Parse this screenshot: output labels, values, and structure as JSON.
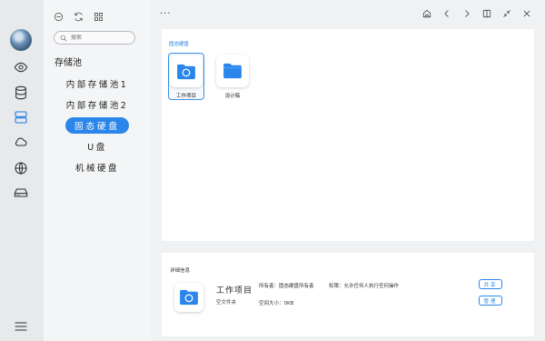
{
  "search": {
    "placeholder": "搜索"
  },
  "nav": {
    "pool_title": "存储池",
    "items": [
      {
        "label": "内部存储池1"
      },
      {
        "label": "内部存储池2"
      },
      {
        "label": "固态硬盘"
      },
      {
        "label": "U盘"
      },
      {
        "label": "机械硬盘"
      }
    ],
    "selected_index": 2
  },
  "main": {
    "more_label": "···",
    "panel_label": "固态硬盘",
    "folders": [
      {
        "label": "工作项目",
        "icon": "folder-open-icon"
      },
      {
        "label": "设计稿",
        "icon": "folder-icon"
      }
    ]
  },
  "detail": {
    "title": "详细信息",
    "name": "工作项目",
    "type": "空文件夹",
    "owner": "所有者：固态硬盘所有者",
    "permission": "权限：允许任何人执行任何操作",
    "space": "空间大小：0KB",
    "share_button": "共享",
    "manage_button": "管理"
  },
  "colors": {
    "accent": "#2a86ea",
    "rail_bg": "#e8e9eb",
    "nav_bg": "#f4f5f6"
  }
}
